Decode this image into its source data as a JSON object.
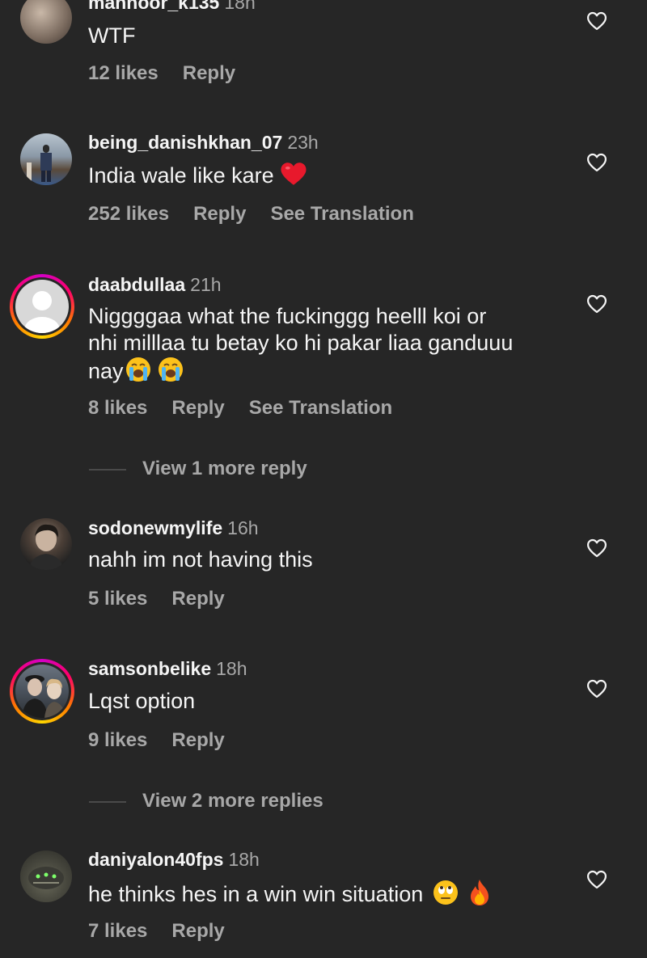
{
  "comments": [
    {
      "username": "mahnoor_k135",
      "time": "18h",
      "text": "WTF",
      "likes": "12 likes",
      "reply": "Reply"
    },
    {
      "username": "being_danishkhan_07",
      "time": "23h",
      "text": "India wale like kare",
      "emoji": "red-heart",
      "likes": "252 likes",
      "reply": "Reply",
      "translate": "See Translation"
    },
    {
      "username": "daabdullaa",
      "time": "21h",
      "text_line1": "Niggggaa what the fuckinggg heelll koi or",
      "text_line2": "nhi milllaa tu betay ko hi pakar liaa ganduuu",
      "text_line3": "nay",
      "emoji": "loudly-crying-face x2",
      "likes": "8 likes",
      "reply": "Reply",
      "translate": "See Translation",
      "view_more": "View 1 more reply"
    },
    {
      "username": "sodonewmylife",
      "time": "16h",
      "text": "nahh im not having this",
      "likes": "5 likes",
      "reply": "Reply"
    },
    {
      "username": "samsonbelike",
      "time": "18h",
      "text": "Lqst option",
      "likes": "9 likes",
      "reply": "Reply",
      "view_more": "View 2 more replies"
    },
    {
      "username": "daniyalon40fps",
      "time": "18h",
      "text": "he thinks hes in a win win situation",
      "emoji": "rolling-eyes, fire",
      "likes": "7 likes",
      "reply": "Reply"
    }
  ],
  "colors": {
    "background": "#262626",
    "primary_text": "#f5f5f5",
    "secondary_text": "#a8a8a8"
  }
}
